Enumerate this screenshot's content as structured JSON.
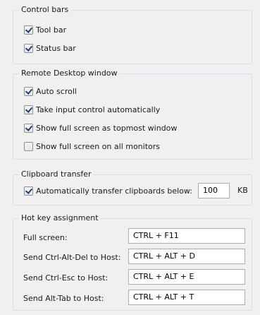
{
  "control_bars": {
    "title": "Control bars",
    "items": [
      {
        "label": "Tool bar",
        "checked": true
      },
      {
        "label": "Status bar",
        "checked": true
      }
    ]
  },
  "remote_desktop": {
    "title": "Remote Desktop window",
    "items": [
      {
        "label": "Auto scroll",
        "checked": true
      },
      {
        "label": "Take input control automatically",
        "checked": true
      },
      {
        "label": "Show full screen as topmost window",
        "checked": true
      },
      {
        "label": "Show full screen on all monitors",
        "checked": false
      }
    ]
  },
  "clipboard": {
    "title": "Clipboard transfer",
    "label": "Automatically transfer clipboards below:",
    "checked": true,
    "value": "100",
    "unit": "KB"
  },
  "hotkeys": {
    "title": "Hot key assignment",
    "items": [
      {
        "label": "Full screen:",
        "value": "CTRL + F11"
      },
      {
        "label": "Send Ctrl-Alt-Del to Host:",
        "value": "CTRL + ALT + D"
      },
      {
        "label": "Send Ctrl-Esc to Host:",
        "value": "CTRL + ALT + E"
      },
      {
        "label": "Send Alt-Tab to Host:",
        "value": "CTRL + ALT + T"
      }
    ]
  }
}
